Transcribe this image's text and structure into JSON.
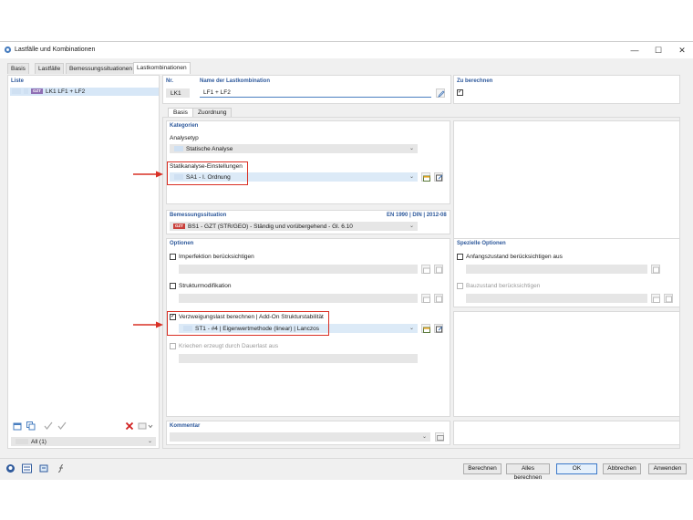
{
  "window": {
    "title": "Lastfälle und Kombinationen",
    "minimize": "—",
    "maximize": "☐",
    "close": "✕"
  },
  "tabs": [
    {
      "label": "Basis"
    },
    {
      "label": "Lastfälle"
    },
    {
      "label": "Bemessungssituationen"
    },
    {
      "label": "Lastkombinationen",
      "active": true
    }
  ],
  "list": {
    "header": "Liste",
    "items": [
      {
        "badge": "GZT",
        "code": "LK1",
        "name": "LF1 + LF2"
      }
    ],
    "filter": "All (1)"
  },
  "header": {
    "nr_label": "Nr.",
    "nr_value": "LK1",
    "name_label": "Name der Lastkombination",
    "name_value": "LF1 + LF2",
    "calc_label": "Zu berechnen",
    "calc_checked": true
  },
  "subtabs": [
    {
      "label": "Basis",
      "active": true
    },
    {
      "label": "Zuordnung"
    }
  ],
  "kategorien": {
    "header": "Kategorien",
    "analysetyp_label": "Analysetyp",
    "analysetyp_value": "Statische Analyse",
    "statik_label": "Statikanalyse-Einstellungen",
    "statik_value": "SA1 - I. Ordnung"
  },
  "bemessung": {
    "header": "Bemessungssituation",
    "norm": "EN 1990 | DIN | 2012-08",
    "badge": "GZT",
    "value": "BS1 - GZT (STR/GEO) - Ständig und vorübergehend - Gl. 6.10"
  },
  "optionen": {
    "header": "Optionen",
    "imperfektion": "Imperfektion berücksichtigen",
    "struktur": "Strukturmodifikation",
    "verzweigung": "Verzweigungslast berechnen | Add-On Strukturstabilität",
    "verzweigung_value": "ST1 - #4 | Eigenwertmethode (linear) | Lanczos",
    "kriechen": "Kriechen erzeugt durch Dauerlast aus"
  },
  "spezielle": {
    "header": "Spezielle Optionen",
    "anfang": "Anfangszustand berücksichtigen aus",
    "bauzustand": "Bauzustand berücksichtigen"
  },
  "kommentar": {
    "header": "Kommentar"
  },
  "buttons": {
    "berechnen": "Berechnen",
    "alles": "Alles berechnen",
    "ok": "OK",
    "abbrechen": "Abbrechen",
    "anwenden": "Anwenden"
  },
  "colors": {
    "accent": "#2f5a9c",
    "highlight_box": "#d93025",
    "gzt_badge": "#c9403b",
    "selection": "#d7e7f7"
  }
}
